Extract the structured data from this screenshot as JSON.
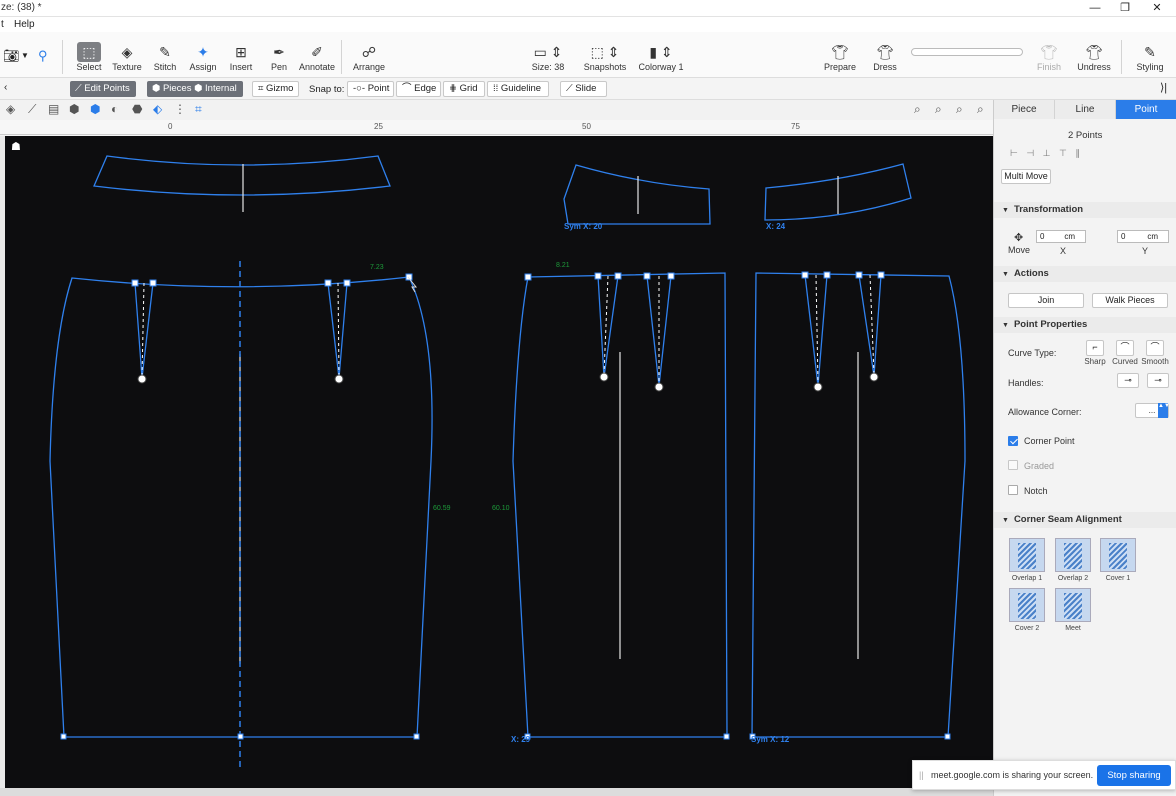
{
  "window": {
    "title": "ze: (38) *",
    "min": "—",
    "restore": "❐",
    "close": "✕"
  },
  "menu": {
    "item0": "t",
    "help": "Help"
  },
  "toolbar": {
    "tools": [
      {
        "label": "Select",
        "glyph": "⬚"
      },
      {
        "label": "Texture",
        "glyph": "◈"
      },
      {
        "label": "Stitch",
        "glyph": "✎"
      },
      {
        "label": "Assign",
        "glyph": "✦"
      },
      {
        "label": "Insert",
        "glyph": "⊞"
      },
      {
        "label": "Pen",
        "glyph": "✒"
      },
      {
        "label": "Annotate",
        "glyph": "✐"
      },
      {
        "label": "Arrange",
        "glyph": "☍"
      }
    ],
    "size": {
      "label": "Size: 38"
    },
    "snapshots": {
      "label": "Snapshots"
    },
    "colorway": {
      "label": "Colorway 1"
    },
    "prepare": {
      "label": "Prepare"
    },
    "dress": {
      "label": "Dress"
    },
    "finish": {
      "label": "Finish"
    },
    "undress": {
      "label": "Undress"
    },
    "styling": {
      "label": "Styling"
    }
  },
  "subtoolbar": {
    "edit_points": "Edit Points",
    "pieces": "Pieces",
    "internal": "Internal",
    "gizmo": "Gizmo",
    "snap_to": "Snap to:",
    "point": "Point",
    "edge": "Edge",
    "grid": "Grid",
    "guideline": "Guideline",
    "slide": "Slide"
  },
  "ruler": {
    "ticks": [
      "0",
      "25",
      "50",
      "75"
    ]
  },
  "canvas": {
    "measure_labels": [
      "7.23",
      "8.21",
      "60.59",
      "60.10"
    ],
    "sym_labels": [
      "Sym X: 20",
      "X: 24",
      "X: 29",
      "Sym X: 12"
    ]
  },
  "panel": {
    "tabs": [
      "Piece",
      "Line",
      "Point"
    ],
    "active_tab": "Point",
    "selection": "2 Points",
    "multi_move": "Multi Move",
    "transformation": {
      "title": "Transformation",
      "move": "Move",
      "x_value": "0",
      "y_value": "0",
      "unit": "cm",
      "x": "X",
      "y": "Y"
    },
    "actions": {
      "title": "Actions",
      "join": "Join",
      "walk_pieces": "Walk Pieces"
    },
    "point_properties": {
      "title": "Point Properties",
      "curve_type": "Curve Type:",
      "sharp": "Sharp",
      "curved": "Curved",
      "smooth": "Smooth",
      "handles": "Handles:",
      "allowance_corner": "Allowance Corner:",
      "allowance_value": "...",
      "corner_point": "Corner Point",
      "graded": "Graded",
      "notch": "Notch"
    },
    "corner_seam": {
      "title": "Corner Seam Alignment",
      "options": [
        "Overlap 1",
        "Overlap 2",
        "Cover 1",
        "Cover 2",
        "Meet"
      ]
    }
  },
  "share_bar": {
    "grip": "||",
    "message": "meet.google.com is sharing your screen.",
    "stop": "Stop sharing"
  },
  "colors": {
    "accent": "#2b7de9",
    "pattern_line": "#2f80ed",
    "canvas_bg": "#0d0d0f",
    "measure": "#1d9a3a"
  }
}
